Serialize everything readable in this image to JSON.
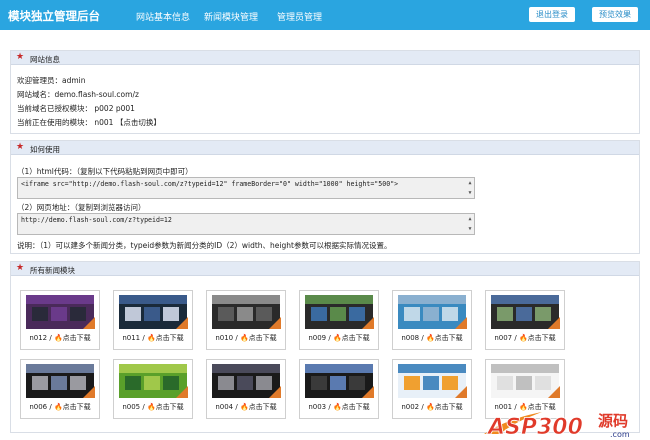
{
  "header": {
    "title": "模块独立管理后台",
    "nav": [
      "网站基本信息",
      "新闻模块管理",
      "管理员管理"
    ],
    "logout": "退出登录",
    "preview": "预览效果"
  },
  "site_info": {
    "title": "网站信息",
    "lines": [
      "欢迎管理员：admin",
      "网站域名：demo.flash-soul.com/z",
      "当前域名已授权模块： p002 p001",
      "当前正在使用的模块： n001 【点击切换】"
    ]
  },
  "usage": {
    "title": "如何使用",
    "code_label": "（1）html代码：（复制以下代码粘贴到网页中即可）",
    "code_value": "<iframe src=\"http://demo.flash-soul.com/z?typeid=12\" frameBorder=\"0\" width=\"1000\" height=\"500\">",
    "url_label": "（2）网页地址：（复制到浏览器访问）",
    "url_value": "http://demo.flash-soul.com/z?typeid=12",
    "note": "说明：（1）可以建多个新闻分类，typeid参数为新闻分类的ID（2）width、height参数可以根据实际情况设置。"
  },
  "modules": {
    "title": "所有新闻模块",
    "download_label": "点击下载",
    "items": [
      "n012",
      "n011",
      "n010",
      "n009",
      "n008",
      "n007",
      "n006",
      "n005",
      "n004",
      "n003",
      "n002",
      "n001"
    ]
  },
  "watermark": {
    "brand": "ASP300",
    "suffix": "源码",
    "domain": ".com"
  }
}
